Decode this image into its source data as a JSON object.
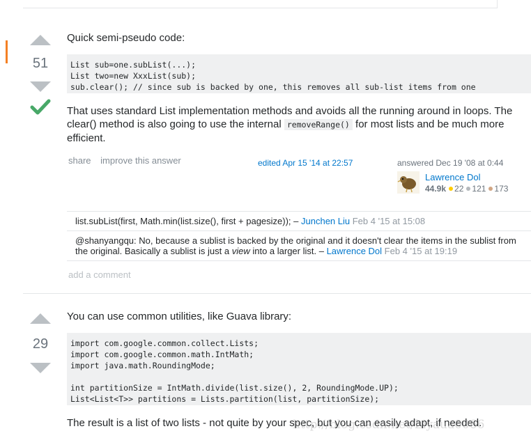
{
  "answer1": {
    "votes": "51",
    "intro": "Quick semi-pseudo code:",
    "code": "List sub=one.subList(...);\nList two=new XxxList(sub);\nsub.clear(); // since sub is backed by one, this removes all sub-list items from one",
    "para_part1": "That uses standard List implementation methods and avoids all the running around in loops. The clear() method is also going to use the internal ",
    "inline_code": "removeRange()",
    "para_part2": " for most lists and be much more efficient.",
    "menu": {
      "share": "share",
      "improve": "improve this answer"
    },
    "edited": "edited Apr 15 '14 at 22:57",
    "answered": "answered Dec 19 '08 at 0:44",
    "user": {
      "name": "Lawrence Dol",
      "rep": "44.9k",
      "gold": "22",
      "silver": "121",
      "bronze": "173"
    },
    "comments": [
      {
        "text": "list.subList(first, Math.min(list.size(), first + pagesize)); – ",
        "author": "Junchen Liu",
        "date": " Feb 4 '15 at 15:08"
      },
      {
        "text1": "@shanyangqu: No, because a sublist is backed by the original and it doesn't clear the items in the sublist from the original. Basically a sublist is just a ",
        "italic": "view",
        "text2": " into a larger list. – ",
        "author": "Lawrence Dol",
        "date": " Feb 4 '15 at 19:19"
      }
    ],
    "add_comment": "add a comment"
  },
  "answer2": {
    "votes": "29",
    "intro": "You can use common utilities, like Guava library:",
    "code": "import com.google.common.collect.Lists;\nimport com.google.common.math.IntMath;\nimport java.math.RoundingMode;\n\nint partitionSize = IntMath.divide(list.size(), 2, RoundingMode.UP);\nList<List<T>> partitions = Lists.partition(list, partitionSize);",
    "result": "The result is a list of two lists - not quite by your spec, but you can easily adapt, if needed."
  },
  "watermark": "http://blog.csdn.net/Liyaua0066",
  "colors": {
    "accent": "#f48024",
    "link": "#0077cc",
    "accepted": "#48a868",
    "gold": "#ffcc01",
    "silver": "#b4b8bc",
    "bronze": "#d1a684"
  }
}
